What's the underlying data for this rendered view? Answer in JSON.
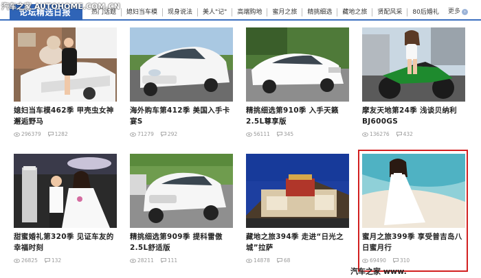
{
  "header": {
    "overlay_text": "汽车之家 AUTOHOME.COM.CN",
    "brand": "论坛精选日报",
    "nav": [
      "热门话题",
      "媳妇当车模",
      "现身说法",
      "美人\"记\"",
      "高端购地",
      "蜜月之旅",
      "精挑细选",
      "藏地之旅",
      "贤配风采",
      "80后婚礼"
    ],
    "more": "更多"
  },
  "cards": [
    {
      "title": "媳妇当车模462季 甲壳虫女神邂逅野马",
      "views": "296379",
      "comments": "1282",
      "selected": false
    },
    {
      "title": "海外购车第412季 美国入手卡宴S",
      "views": "71279",
      "comments": "292",
      "selected": false
    },
    {
      "title": "精挑细选第910季 入手天籁2.5L尊享版",
      "views": "56111",
      "comments": "345",
      "selected": false
    },
    {
      "title": "摩友天地第24季 浅谈贝纳利BJ600GS",
      "views": "136276",
      "comments": "432",
      "selected": false
    },
    {
      "title": "甜蜜婚礼第320季 见证车友的幸福时刻",
      "views": "26825",
      "comments": "132",
      "selected": false
    },
    {
      "title": "精挑细选第909季 提科雷傲2.5L舒适版",
      "views": "28211",
      "comments": "111",
      "selected": false
    },
    {
      "title": "藏地之旅394季 走进“日光之城”拉萨",
      "views": "14878",
      "comments": "68",
      "selected": false
    },
    {
      "title": "蜜月之旅399季 享受普吉岛八日蜜月行",
      "views": "69490",
      "comments": "310",
      "selected": true
    }
  ],
  "watermark": "汽车之家 www. AUTOHOME.COM.CN",
  "colors": {
    "accent": "#2f64b7",
    "selected_border": "#d21f1f"
  },
  "icons": {
    "views": "eye-icon",
    "comments": "comment-icon"
  }
}
